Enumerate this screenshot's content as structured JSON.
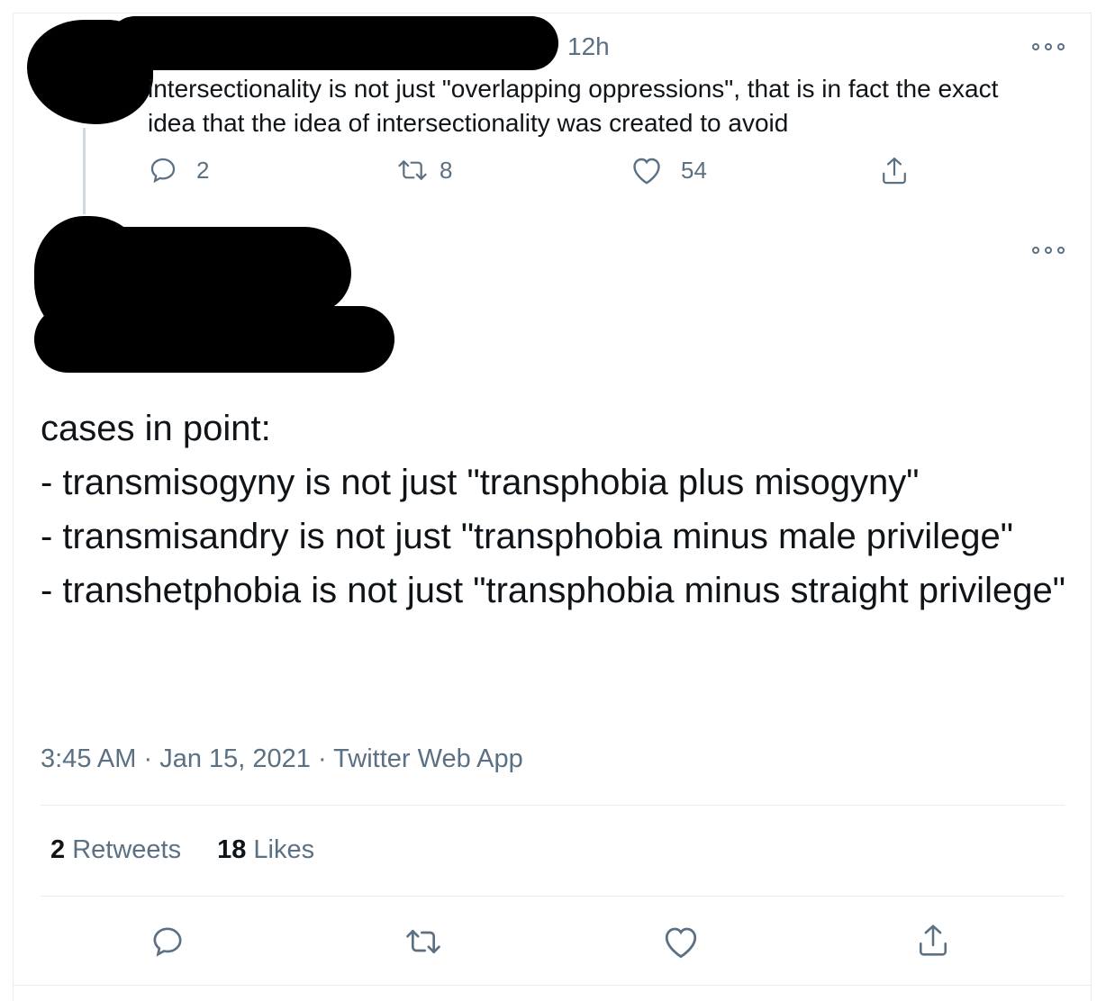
{
  "reply_tweet": {
    "time_ago": "12h",
    "text": "intersectionality is not just \"overlapping oppressions\", that is in fact the exact idea that the idea of intersectionality was created to avoid",
    "reply_count": "2",
    "retweet_count": "8",
    "like_count": "54"
  },
  "main_tweet": {
    "text": "cases in point:\n- transmisogyny is not just \"transphobia plus misogyny\"\n- transmisandry is not just \"transphobia minus male privilege\"\n- transhetphobia is not just \"transphobia minus straight privilege\"",
    "time": "3:45 AM",
    "date": "Jan 15, 2021",
    "source": "Twitter Web App",
    "retweets_num": "2",
    "retweets_label": "Retweets",
    "likes_num": "18",
    "likes_label": "Likes"
  },
  "icons": {
    "reply": "reply-icon",
    "retweet": "retweet-icon",
    "like": "heart-icon",
    "share": "share-icon",
    "more": "more-icon"
  },
  "colors": {
    "text": "#0f1419",
    "secondary": "#5b7083",
    "divider": "#e6ecf0",
    "thread": "#cfd9de"
  }
}
